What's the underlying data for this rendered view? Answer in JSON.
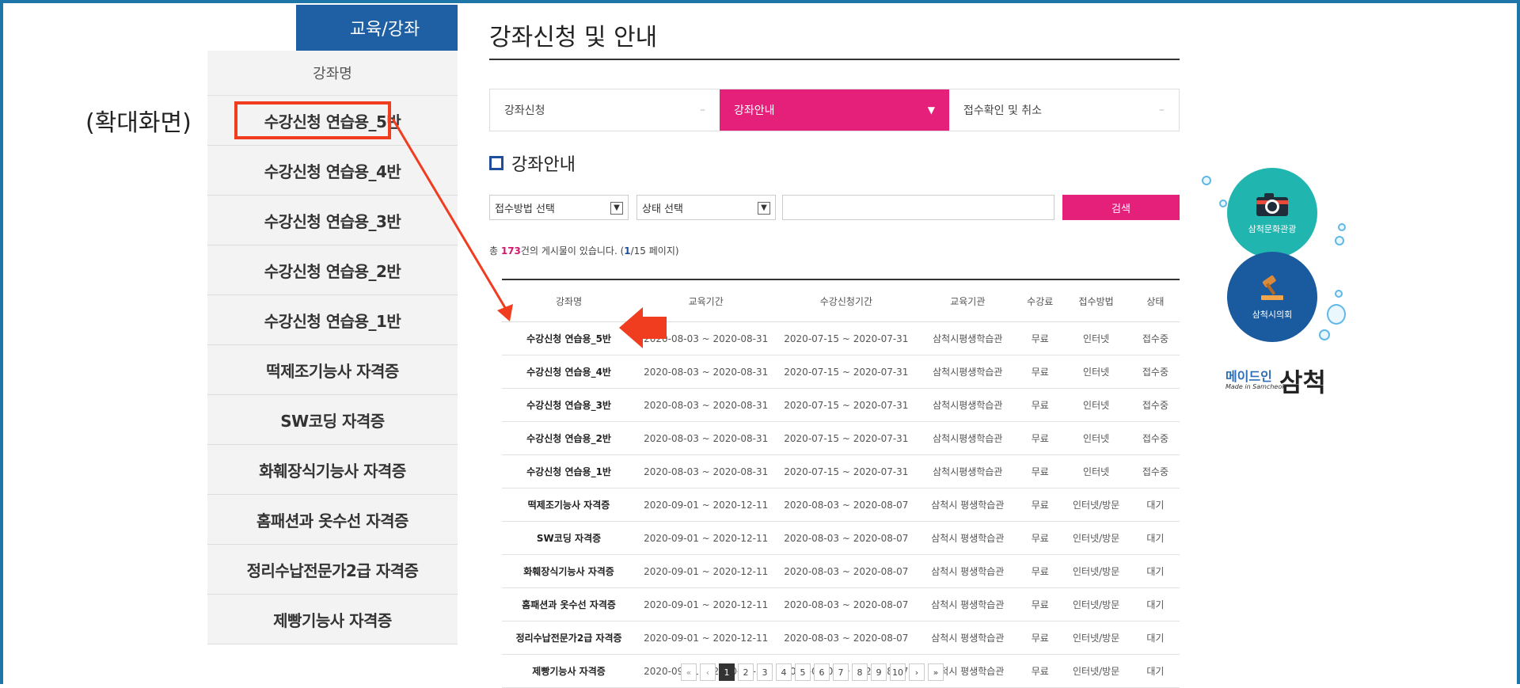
{
  "annotation": {
    "zoom_label": "(확대화면)"
  },
  "sidebar": {
    "header": "교육/강좌",
    "title": "강좌명",
    "items": [
      {
        "label": "수강신청 연습용_5반"
      },
      {
        "label": "수강신청 연습용_4반"
      },
      {
        "label": "수강신청 연습용_3반"
      },
      {
        "label": "수강신청 연습용_2반"
      },
      {
        "label": "수강신청 연습용_1반"
      },
      {
        "label": "떡제조기능사 자격증"
      },
      {
        "label": "SW코딩 자격증"
      },
      {
        "label": "화훼장식기능사 자격증"
      },
      {
        "label": "홈패션과 옷수선 자격증"
      },
      {
        "label": "정리수납전문가2급 자격증"
      },
      {
        "label": "제빵기능사 자격증"
      }
    ]
  },
  "main": {
    "title": "강좌신청 및 안내",
    "tabs": [
      {
        "label": "강좌신청",
        "active": false
      },
      {
        "label": "강좌안내",
        "active": true
      },
      {
        "label": "접수확인 및 취소",
        "active": false
      }
    ],
    "section_title": "강좌안내",
    "search": {
      "method_select": "접수방법 선택",
      "status_select": "상태 선택",
      "search_value": "",
      "search_button": "검색"
    },
    "summary": {
      "prefix": "총 ",
      "count": "173",
      "middle": "건의 게시물이 있습니다. (",
      "current": "1",
      "suffix": "/15 페이지)"
    },
    "table": {
      "headers": [
        "강좌명",
        "교육기간",
        "수강신청기간",
        "교육기관",
        "수강료",
        "접수방법",
        "상태"
      ],
      "rows": [
        [
          "수강신청 연습용_5반",
          "2020-08-03 ~ 2020-08-31",
          "2020-07-15 ~ 2020-07-31",
          "삼척시평생학습관",
          "무료",
          "인터넷",
          "접수중"
        ],
        [
          "수강신청 연습용_4반",
          "2020-08-03 ~ 2020-08-31",
          "2020-07-15 ~ 2020-07-31",
          "삼척시평생학습관",
          "무료",
          "인터넷",
          "접수중"
        ],
        [
          "수강신청 연습용_3반",
          "2020-08-03 ~ 2020-08-31",
          "2020-07-15 ~ 2020-07-31",
          "삼척시평생학습관",
          "무료",
          "인터넷",
          "접수중"
        ],
        [
          "수강신청 연습용_2반",
          "2020-08-03 ~ 2020-08-31",
          "2020-07-15 ~ 2020-07-31",
          "삼척시평생학습관",
          "무료",
          "인터넷",
          "접수중"
        ],
        [
          "수강신청 연습용_1반",
          "2020-08-03 ~ 2020-08-31",
          "2020-07-15 ~ 2020-07-31",
          "삼척시평생학습관",
          "무료",
          "인터넷",
          "접수중"
        ],
        [
          "떡제조기능사 자격증",
          "2020-09-01 ~ 2020-12-11",
          "2020-08-03 ~ 2020-08-07",
          "삼척시 평생학습관",
          "무료",
          "인터넷/방문",
          "대기"
        ],
        [
          "SW코딩 자격증",
          "2020-09-01 ~ 2020-12-11",
          "2020-08-03 ~ 2020-08-07",
          "삼척시 평생학습관",
          "무료",
          "인터넷/방문",
          "대기"
        ],
        [
          "화훼장식기능사 자격증",
          "2020-09-01 ~ 2020-12-11",
          "2020-08-03 ~ 2020-08-07",
          "삼척시 평생학습관",
          "무료",
          "인터넷/방문",
          "대기"
        ],
        [
          "홈패션과 옷수선 자격증",
          "2020-09-01 ~ 2020-12-11",
          "2020-08-03 ~ 2020-08-07",
          "삼척시 평생학습관",
          "무료",
          "인터넷/방문",
          "대기"
        ],
        [
          "정리수납전문가2급 자격증",
          "2020-09-01 ~ 2020-12-11",
          "2020-08-03 ~ 2020-08-07",
          "삼척시 평생학습관",
          "무료",
          "인터넷/방문",
          "대기"
        ],
        [
          "제빵기능사 자격증",
          "2020-09-01 ~ 2020-11-23",
          "2020-08-03 ~ 2020-08-07",
          "삼척시 평생학습관",
          "무료",
          "인터넷/방문",
          "대기"
        ]
      ]
    },
    "pagination": {
      "first": "«",
      "prev": "‹",
      "pages": [
        "1",
        "2",
        "3",
        "4",
        "5",
        "6",
        "7",
        "8",
        "9",
        "10"
      ],
      "current": "1",
      "next": "›",
      "last": "»"
    }
  },
  "side_widgets": {
    "culture": {
      "label": "삼척문화관광",
      "icon": "camera-icon"
    },
    "council": {
      "label": "삼척시의회",
      "icon": "gavel-icon"
    },
    "brand": {
      "small": "메이드인",
      "sub": "Made in Samcheok",
      "big": "삼척"
    }
  },
  "colors": {
    "accent_pink": "#e5207b",
    "nav_blue": "#1f5fa3",
    "frame_blue": "#1e76a8",
    "annotation_red": "#f03c1f"
  }
}
